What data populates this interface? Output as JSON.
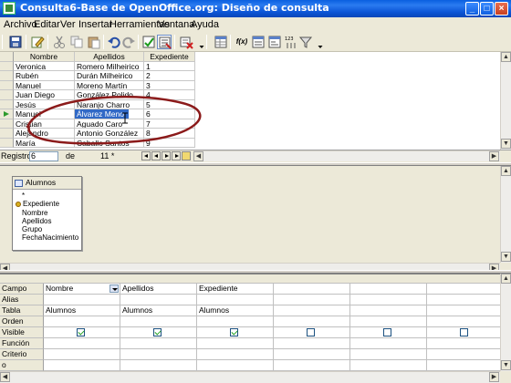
{
  "window": {
    "title": "Consulta6-Base de OpenOffice.org: Diseño de consulta",
    "buttons": {
      "minimize": "_",
      "maximize": "□",
      "close": "×"
    }
  },
  "menu": [
    "Archivo",
    "Editar",
    "Ver",
    "Insertar",
    "Herramientas",
    "Ventana",
    "Ayuda"
  ],
  "toolbar": {
    "icons": [
      "save-icon",
      "edit-icon",
      "cut-icon",
      "copy-icon",
      "paste-icon",
      "undo-icon",
      "redo-icon",
      "design-view-icon",
      "sql-view-icon",
      "clear-query-icon",
      "table-add-icon",
      "functions-icon",
      "table-names-icon",
      "alias-icon",
      "distinct-values-icon",
      "filter-icon"
    ],
    "fx_label": "f(x)"
  },
  "results": {
    "columns": [
      "Nombre",
      "Apellidos",
      "Expediente"
    ],
    "rows": [
      [
        "Veronica",
        "Romero Milheirico",
        "1"
      ],
      [
        "Rubén",
        "Durán Milheirico",
        "2"
      ],
      [
        "Manuel",
        "Moreno Martín",
        "3"
      ],
      [
        "Juan Diego",
        "González Polido",
        "4"
      ],
      [
        "Jesús",
        "Naranjo Charro",
        "5"
      ],
      [
        "Manuel",
        "Álvarez Menor",
        "6"
      ],
      [
        "Cristian",
        "Aguado Caro",
        "7"
      ],
      [
        "Alejandro",
        "Antonio González",
        "8"
      ],
      [
        "María",
        "Caballo Santos",
        "9"
      ]
    ],
    "selected_row": 6
  },
  "record_nav": {
    "label": "Registro",
    "current": "6",
    "of_label": "de",
    "total": "11 *"
  },
  "table_box": {
    "name": "Alumnos",
    "fields": [
      "*",
      "Expediente",
      "Nombre",
      "Apellidos",
      "Grupo",
      "FechaNacimiento"
    ],
    "key_field": "Expediente"
  },
  "criteria": {
    "row_labels": [
      "Campo",
      "Alias",
      "Tabla",
      "Orden",
      "Visible",
      "Función",
      "Criterio",
      "o"
    ],
    "columns": [
      {
        "campo": "Nombre",
        "tabla": "Alumnos",
        "visible": true
      },
      {
        "campo": "Apellidos",
        "tabla": "Alumnos",
        "visible": true
      },
      {
        "campo": "Expediente",
        "tabla": "Alumnos",
        "visible": true
      },
      {
        "campo": "",
        "tabla": "",
        "visible": false
      },
      {
        "campo": "",
        "tabla": "",
        "visible": false
      },
      {
        "campo": "",
        "tabla": "",
        "visible": false
      }
    ]
  },
  "colors": {
    "title_bar": "#0a5fe0",
    "selection": "#3169c6",
    "annotation": "#8b1a1a",
    "window_bg": "#ece9d8"
  }
}
